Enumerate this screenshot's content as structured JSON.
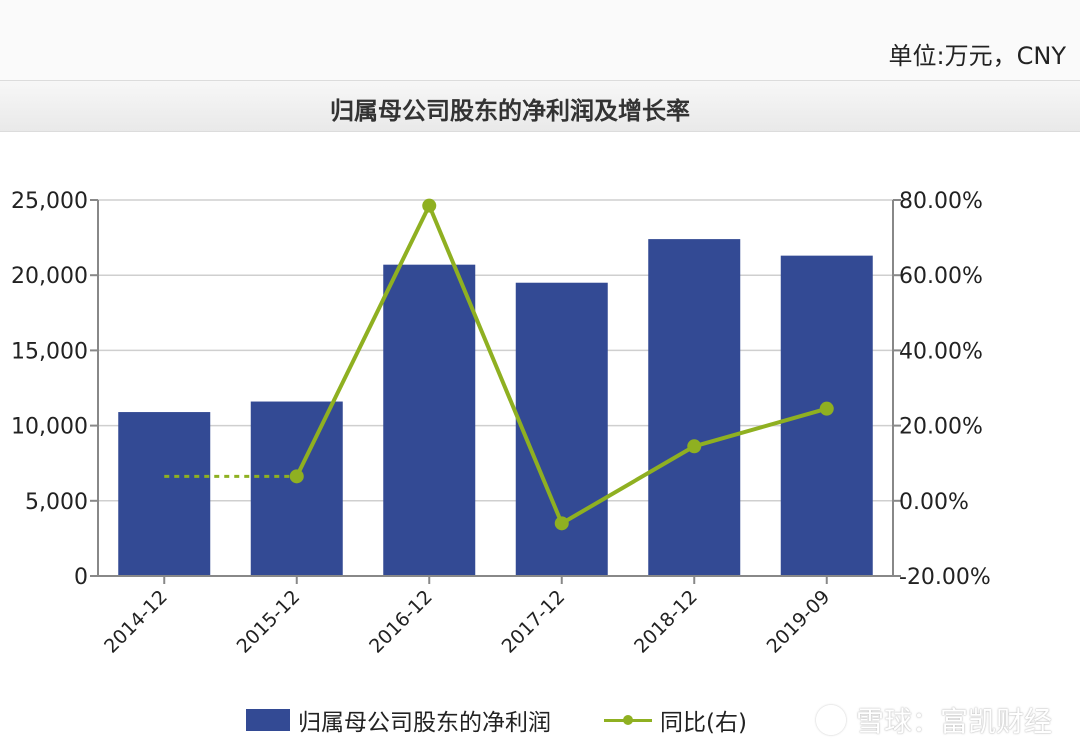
{
  "header": {
    "unit_label": "单位:万元，CNY",
    "title": "归属母公司股东的净利润及增长率"
  },
  "legend": {
    "bar_label": "归属母公司股东的净利润",
    "line_label": "同比(右)"
  },
  "watermark": {
    "text": "雪球：富凯财经"
  },
  "colors": {
    "bar": "#334a94",
    "line": "#8fb021",
    "grid": "#cfcfcf",
    "axis": "#888888"
  },
  "chart_data": {
    "type": "bar",
    "categories": [
      "2014-12",
      "2015-12",
      "2016-12",
      "2017-12",
      "2018-12",
      "2019-09"
    ],
    "series": [
      {
        "name": "归属母公司股东的净利润",
        "type": "bar",
        "axis": "left",
        "values": [
          10900,
          11600,
          20700,
          19500,
          22400,
          21300
        ]
      },
      {
        "name": "同比(右)",
        "type": "line",
        "axis": "right",
        "values": [
          6.5,
          6.5,
          78.5,
          -6.0,
          14.5,
          24.5
        ],
        "dashed_segments": [
          [
            0,
            1
          ]
        ]
      }
    ],
    "y_left": {
      "min": 0,
      "max": 25000,
      "ticks": [
        "0",
        "5,000",
        "10,000",
        "15,000",
        "20,000",
        "25,000"
      ]
    },
    "y_right": {
      "min": -20,
      "max": 80,
      "ticks": [
        "-20.00%",
        "0.00%",
        "20.00%",
        "40.00%",
        "60.00%",
        "80.00%"
      ]
    },
    "grid": true,
    "legend_position": "bottom"
  }
}
